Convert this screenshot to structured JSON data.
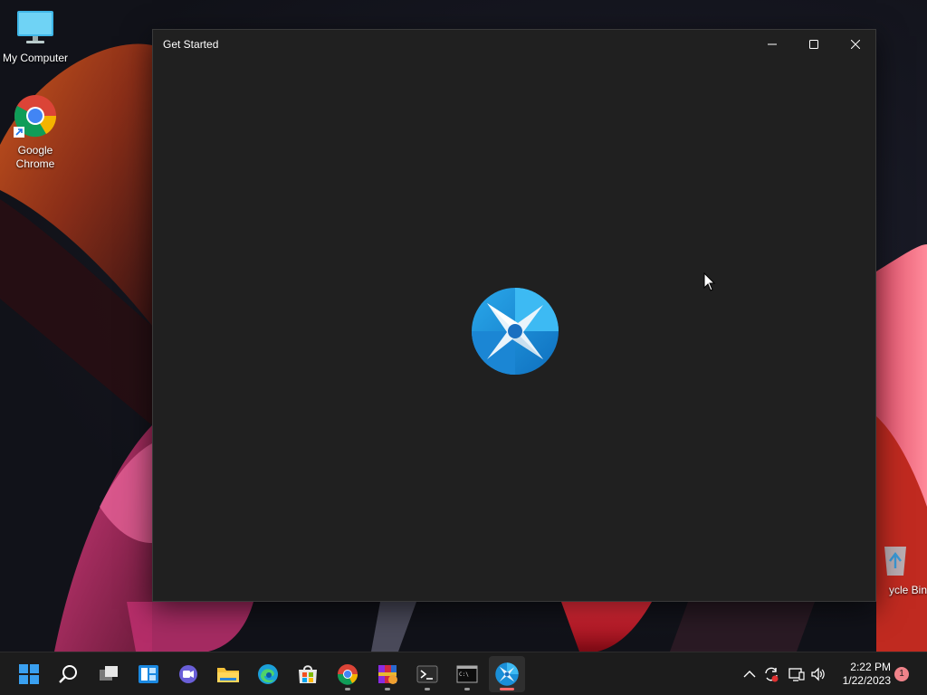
{
  "desktop": {
    "icons": [
      {
        "label": "My Computer",
        "icon": "monitor-icon"
      },
      {
        "label": "Google Chrome",
        "icon": "chrome-icon"
      },
      {
        "label": "Recycle Bin",
        "icon": "recycle-bin-icon",
        "visible_text": "ycle Bin"
      }
    ]
  },
  "window": {
    "title": "Get Started",
    "controls": [
      "minimize",
      "maximize",
      "close"
    ],
    "logo_icon": "app-star-logo-icon"
  },
  "taskbar": {
    "apps": [
      {
        "name": "Start",
        "icon": "windows-start-icon"
      },
      {
        "name": "Search",
        "icon": "search-icon"
      },
      {
        "name": "Task View",
        "icon": "task-view-icon"
      },
      {
        "name": "Widgets",
        "icon": "widgets-icon"
      },
      {
        "name": "Chat",
        "icon": "chat-icon"
      },
      {
        "name": "File Explorer",
        "icon": "folder-icon"
      },
      {
        "name": "Microsoft Edge",
        "icon": "edge-icon"
      },
      {
        "name": "Microsoft Store",
        "icon": "store-icon"
      },
      {
        "name": "Google Chrome",
        "icon": "chrome-icon"
      },
      {
        "name": "WinRAR",
        "icon": "winrar-icon"
      },
      {
        "name": "Terminal",
        "icon": "terminal-icon"
      },
      {
        "name": "Command Prompt",
        "icon": "cmd-icon"
      },
      {
        "name": "Get Started",
        "icon": "app-star-logo-icon"
      }
    ],
    "tray": {
      "icons": [
        "chevron-up-icon",
        "sync-icon",
        "network-icon",
        "volume-icon"
      ],
      "time": "2:22 PM",
      "date": "1/22/2023",
      "notification_count": "1"
    }
  },
  "colors": {
    "window_bg": "#202020",
    "taskbar_bg": "#1c1c1c",
    "accent_blue": "#1a8fd8",
    "active_indicator": "#ff6b6b"
  }
}
